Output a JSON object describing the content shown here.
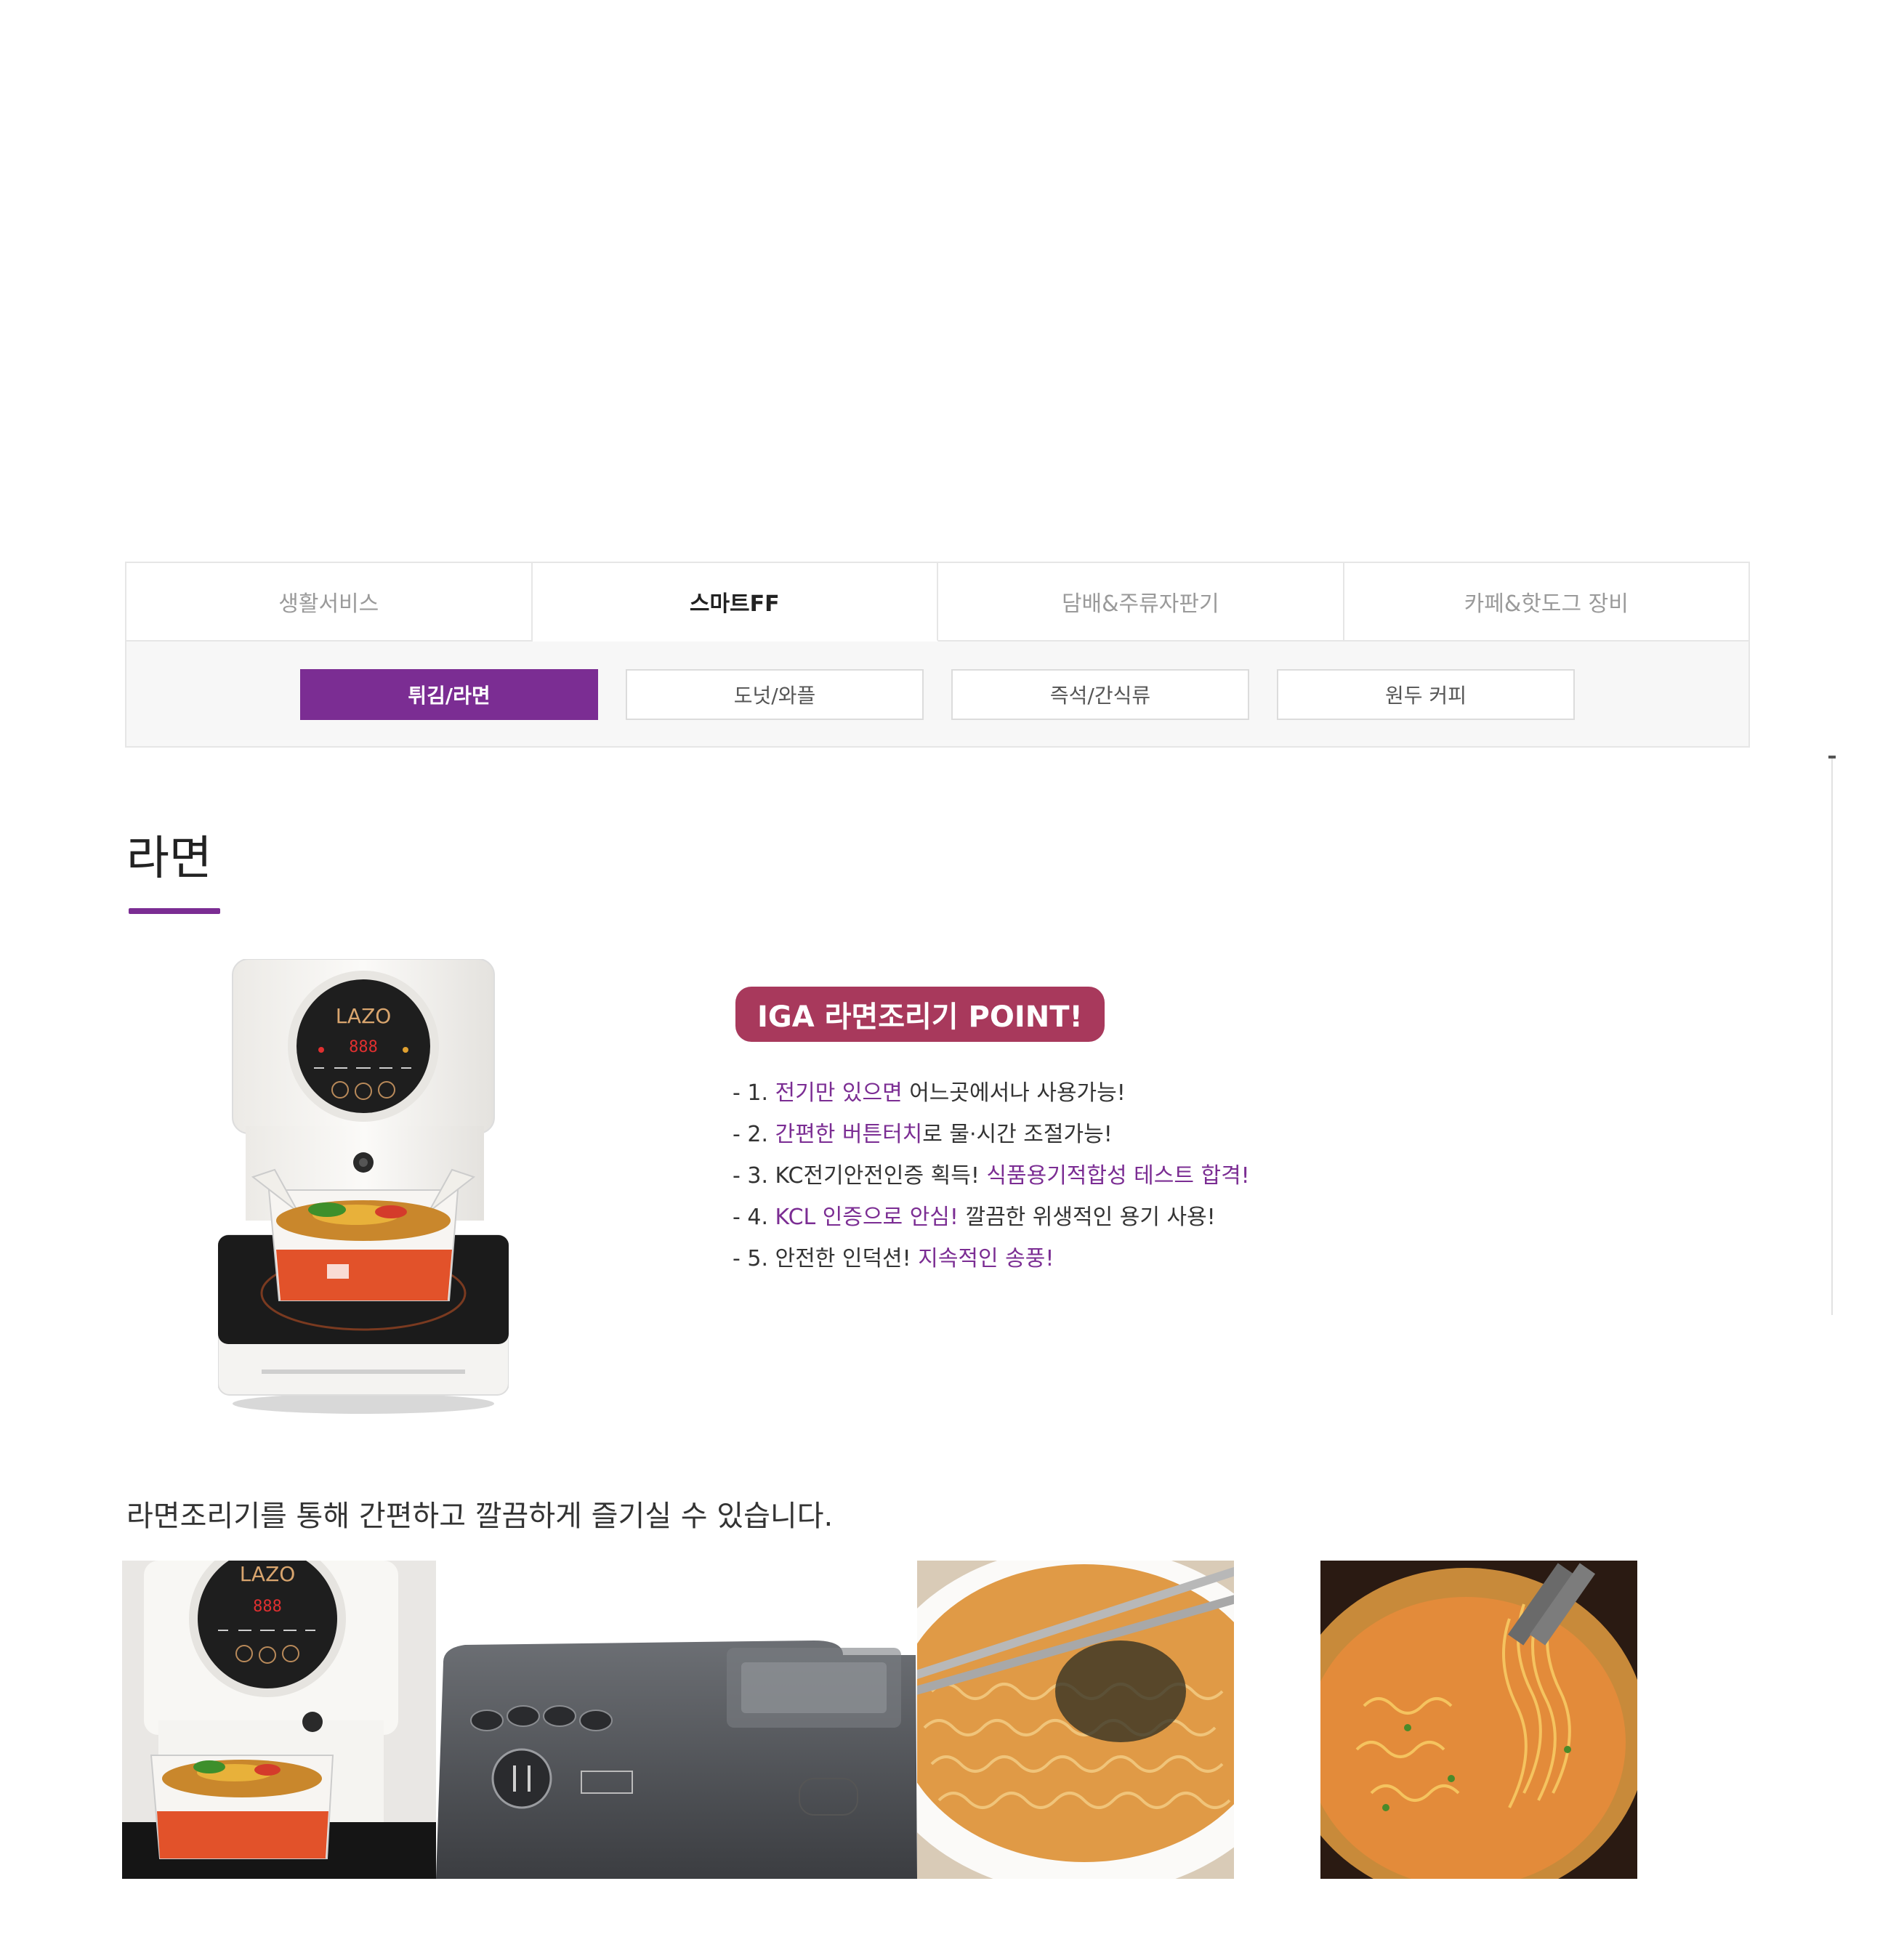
{
  "tabs": {
    "main": [
      {
        "label": "생활서비스",
        "active": false
      },
      {
        "label": "스마트FF",
        "active": true
      },
      {
        "label": "담배&주류자판기",
        "active": false
      },
      {
        "label": "카페&핫도그 장비",
        "active": false
      }
    ],
    "sub": [
      {
        "label": "튀김/라면",
        "active": true
      },
      {
        "label": "도넛/와플",
        "active": false
      },
      {
        "label": "즉석/간식류",
        "active": false
      },
      {
        "label": "원두 커피",
        "active": false
      }
    ]
  },
  "section": {
    "title": "라면",
    "product_brand": "LAZO",
    "product_display": "888"
  },
  "points": {
    "badge": "IGA 라면조리기 POINT!",
    "items": [
      {
        "prefix": "- 1. ",
        "hl1": "전기만 있으면",
        "mid": " 어느곳에서나 사용가능!",
        "hl2": "",
        "tail": ""
      },
      {
        "prefix": "- 2. ",
        "hl1": "간편한 버튼터치",
        "mid": "로 물·시간 조절가능!",
        "hl2": "",
        "tail": ""
      },
      {
        "prefix": "- 3. KC전기안전인증 획득! ",
        "hl1": "",
        "mid": "",
        "hl2": "식품용기적합성 테스트 합격!",
        "tail": ""
      },
      {
        "prefix": "- 4. ",
        "hl1": "KCL 인증으로 안심!",
        "mid": " 깔끔한 위생적인 용기 사용!",
        "hl2": "",
        "tail": ""
      },
      {
        "prefix": "- 5. 안전한 인덕션! ",
        "hl1": "",
        "mid": "",
        "hl2": "지속적인 송풍!",
        "tail": ""
      }
    ]
  },
  "caption": "라면조리기를 통해 간편하고 깔끔하게 즐기실 수 있습니다.",
  "colors": {
    "accent": "#7b2d93",
    "badge": "#a8395c"
  }
}
